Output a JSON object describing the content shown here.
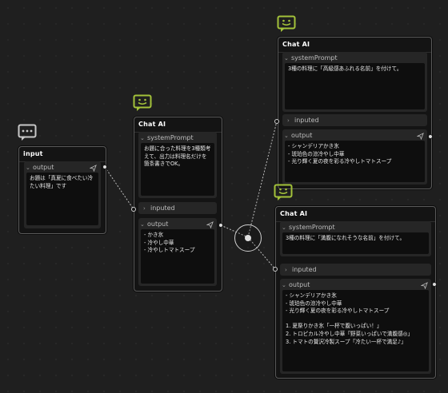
{
  "colors": {
    "badge_green": "#a3c23a",
    "badge_gray": "#c8c8c8",
    "background": "#1f1f1f"
  },
  "input_node": {
    "title": "input",
    "output_label": "output",
    "output_text": "お題は「真夏に食べたい冷たい料理」です",
    "badge_icon": "chat-bubble-dots-icon"
  },
  "chat_mid": {
    "title": "Chat AI",
    "system_label": "systemPrompt",
    "system_text": "お題に合った料理を3種類考えて、出力は料理名だけを箇条書きでOK。",
    "inputed_label": "inputed",
    "output_label": "output",
    "output_text": "- かき氷\n- 冷やし中華\n- 冷やしトマトスープ",
    "badge_icon": "smiley-chat-icon"
  },
  "chat_top": {
    "title": "Chat AI",
    "system_label": "systemPrompt",
    "system_text": "3種の料理に「高級感あふれる名前」を付けて。",
    "inputed_label": "inputed",
    "output_label": "output",
    "output_text": "- シャンデリアかき氷\n- 琥珀色の涼冷やし中華\n- 光り輝く夏の夜を彩る冷やしトマトスープ",
    "badge_icon": "smiley-chat-icon"
  },
  "chat_bottom": {
    "title": "Chat AI",
    "system_label": "systemPrompt",
    "system_text": "3種の料理に「満腹になれそうな名前」を付けて。",
    "inputed_label": "inputed",
    "output_label": "output",
    "output_text": "- シャンデリアかき氷\n- 琥珀色の涼冷やし中華\n- 光り輝く夏の夜を彩る冷やしトマトスープ\n\n1. 夏祭りかき氷「一杯で腹いっぱい！」\n2. トロピカル冷やし中華「野菜いっぱいで満腹感◎」\n3. トマトの贅沢冷製スープ「冷たい一杯で満足♪」",
    "badge_icon": "smiley-chat-icon"
  },
  "hub": {
    "icon": "split-hub-icon"
  }
}
